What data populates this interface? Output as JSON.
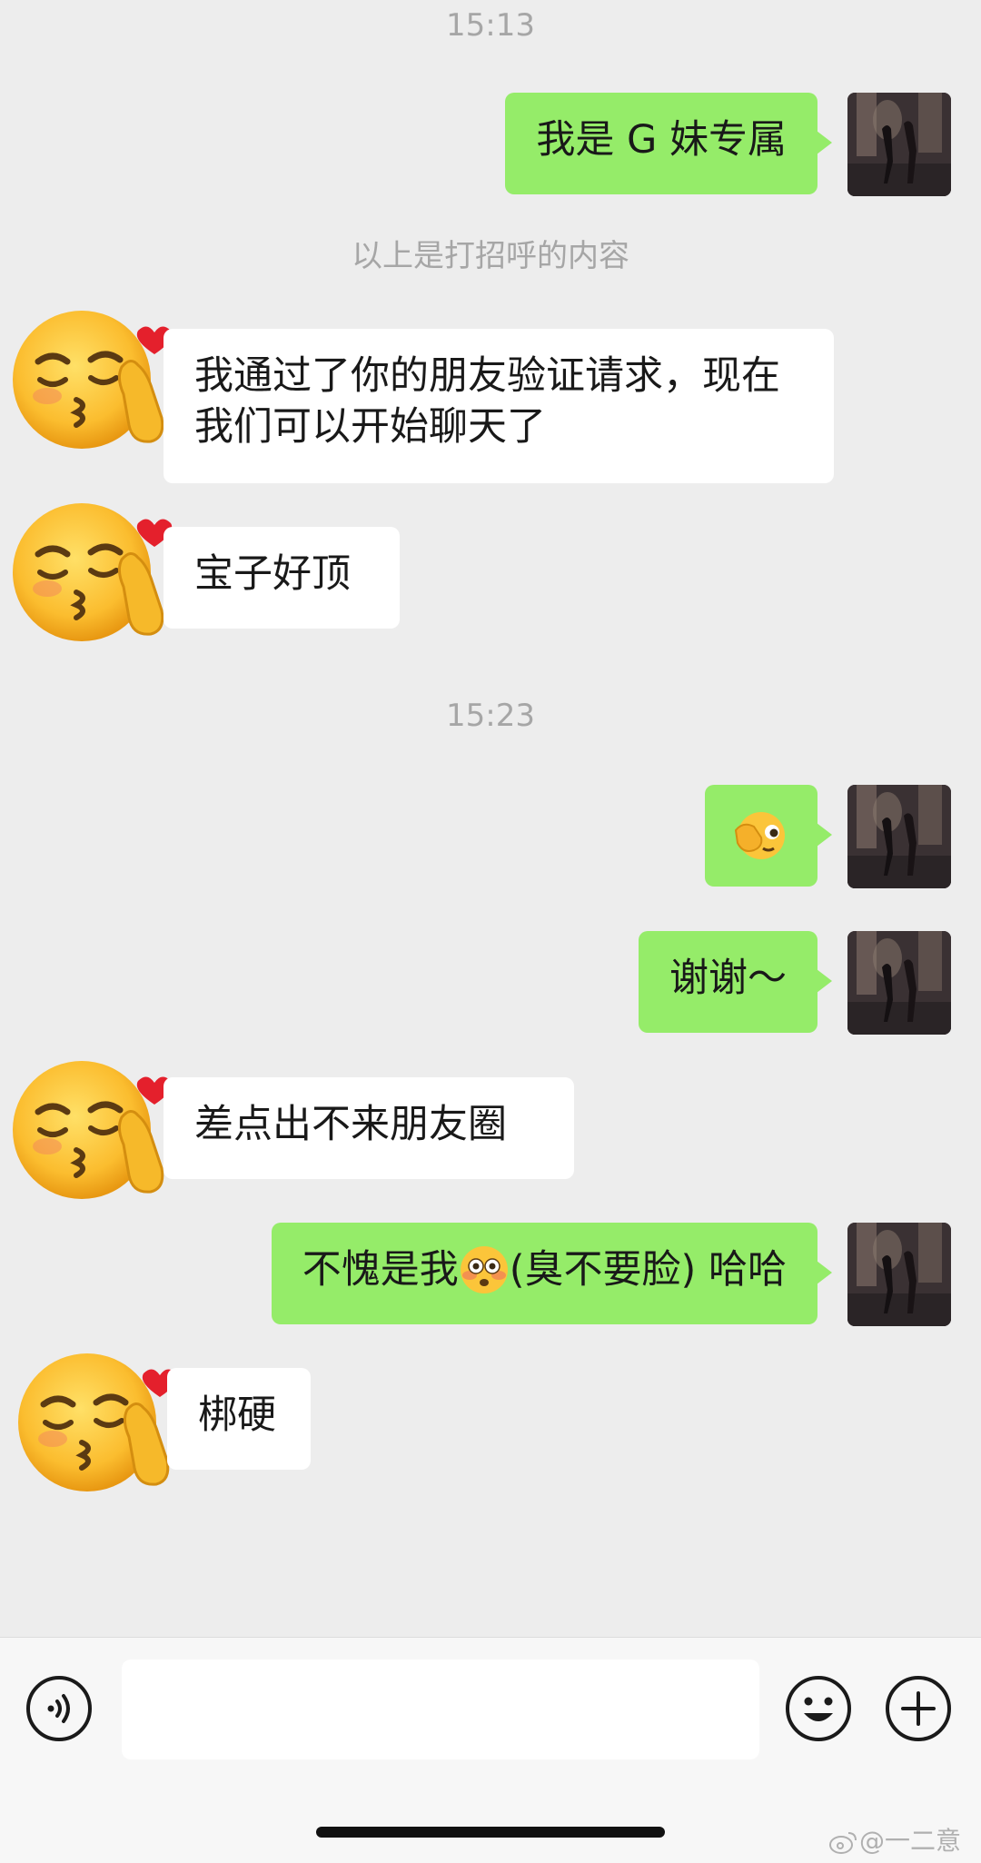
{
  "chat": {
    "timestamps": [
      "15:13",
      "15:23"
    ],
    "system_note": "以上是打招呼的内容",
    "messages": [
      {
        "from": "me",
        "text": "我是 G 妹专属"
      },
      {
        "from": "peer",
        "text": "我通过了你的朋友验证请求，现在我们可以开始聊天了"
      },
      {
        "from": "peer",
        "text": "宝子好顶"
      },
      {
        "from": "me",
        "emoji": "face-with-hand-over-eye-icon"
      },
      {
        "from": "me",
        "text": "谢谢～"
      },
      {
        "from": "peer",
        "text": "差点出不来朋友圈"
      },
      {
        "from": "me",
        "text_before": "不愧是我",
        "emoji": "flushed-face-icon",
        "text_after": "(臭不要脸) 哈哈"
      },
      {
        "from": "peer",
        "text": "梆硬"
      }
    ]
  },
  "input_bar": {
    "placeholder": "",
    "value": ""
  },
  "watermark": "@一二意",
  "colors": {
    "background": "#ededed",
    "outgoing_bubble": "#95ec69",
    "incoming_bubble": "#ffffff",
    "timestamp_text": "#a6a6a6"
  }
}
